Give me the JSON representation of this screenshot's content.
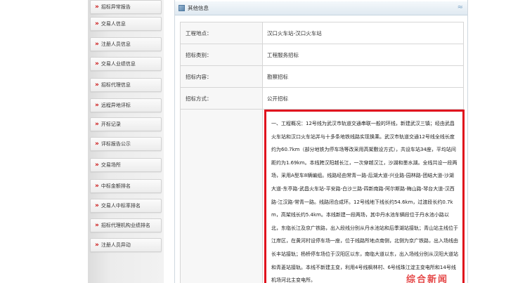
{
  "sidebar": {
    "items": [
      {
        "label": "招标异常报告"
      },
      {
        "label": "交易人信息"
      },
      {
        "label": "注册人员信息"
      },
      {
        "label": "交易人业绩信息"
      },
      {
        "label": "招标代理信息"
      },
      {
        "label": "远程异地评标"
      },
      {
        "label": "开标记录"
      },
      {
        "label": "评标报告公示"
      },
      {
        "label": "交易场所"
      },
      {
        "label": "中标金额排名"
      },
      {
        "label": "交易人中标率排名"
      },
      {
        "label": "招标代理机构业绩排名"
      },
      {
        "label": "注册人员异动"
      }
    ]
  },
  "panel": {
    "title": "其他信息",
    "collapse_glyph": "≈"
  },
  "info": {
    "rows": [
      {
        "key": "工程地点：",
        "value": "汉口火车站-汉口火车站"
      },
      {
        "key": "招标类别：",
        "value": "工程服务招标"
      },
      {
        "key": "招标内容：",
        "value": "勘察招标"
      },
      {
        "key": "招标方式：",
        "value": "公开招标"
      }
    ],
    "description_key": "",
    "description": "一、工程概况：12号线为武汉市轨道交通串联一般的环线，新建武汉三镇；经由武昌火车站和汉口火车站并与十多条地铁线路实现换乘。武汉市轨道交通12号线全线长度约为60.7km（部分地铁为停车场等改采用高架敷设方式），共设车站34座，平均站间距约为1.69km。本线跨汉阳越长江，一次穿越汉江，沙湖和墨水湖。全线共设一段两场，采用A型车8辆编组。线路经由常青一路-后湖大道-兴业路-园林路-团结大道-沙湖大道-东亭路-武昌火车站-平安路-白沙三路-四新南路-阿尔斯路-梅山路-琴台大道-汉西路-江汉路-常青一路。线路闭合成环。12号线地下线长约54.6km，过渡段长约0.7km，高架线长约5.4km。本线新建一段两场，其中丹水池车辆段位于丹水池小路以北，东临长江及京广铁路，出入段线分别从丹水池站和后季湖站接轨；青山站主线位于江岸区，在黄河村设停车场一座，位于线路所地点南侧，北侧为京广铁路，出入场线由长丰站接轨；杨桥停车场位于汉阳区以东，南临大道以东，出入场线分别从汉阳大道站和青菱站接轨。本线不新建主变，利用4号线枫林村、6号线珠江淀主变电所和14号线机场河北主变电所。"
  },
  "watermark": {
    "text": "综合新闻"
  }
}
